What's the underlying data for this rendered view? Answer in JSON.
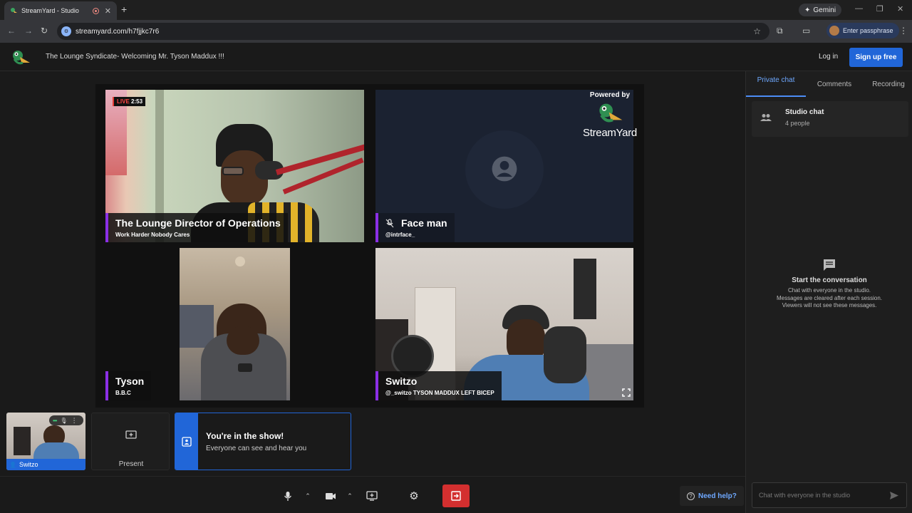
{
  "browser": {
    "tab_title": "StreamYard - Studio",
    "new_tab": "+",
    "gemini_label": "Gemini",
    "url": "streamyard.com/h7fjjkc7r6",
    "profile_label": "Enter passphrase"
  },
  "header": {
    "title": "The Lounge Syndicate- Welcoming Mr. Tyson Maddux !!!",
    "login": "Log in",
    "signup": "Sign up free"
  },
  "stage": {
    "live_label": "LIVE",
    "live_time": "2:53",
    "powered_by": "Powered by",
    "brand": "StreamYard",
    "participants": [
      {
        "name": "The Lounge Director of Operations",
        "sub": "Work Harder Nobody Cares"
      },
      {
        "name": "Face man",
        "sub": "@intrface_"
      },
      {
        "name": "Tyson",
        "sub": "B.B.C"
      },
      {
        "name": "Switzo",
        "sub": "@_switzo TYSON MADDUX LEFT BICEP"
      }
    ]
  },
  "self_preview": {
    "name": "Switzo"
  },
  "present": {
    "label": "Present"
  },
  "notice": {
    "title": "You're in the show!",
    "body": "Everyone can see and hear you"
  },
  "sidebar": {
    "tabs": [
      {
        "label": "Private chat"
      },
      {
        "label": "Comments"
      },
      {
        "label": "Recording"
      }
    ],
    "studio_chat": {
      "title": "Studio chat",
      "count": "4 people"
    },
    "empty_title": "Start the conversation",
    "empty_lines": [
      "Chat with everyone in the studio.",
      "Messages are cleared after each session.",
      "Viewers will not see these messages."
    ],
    "chat_placeholder": "Chat with everyone in the studio"
  },
  "controls": {
    "help": "Need help?"
  },
  "colors": {
    "accent": "#2166d8",
    "name_bar": "#8b2fe6",
    "leave": "#d32f2f"
  }
}
